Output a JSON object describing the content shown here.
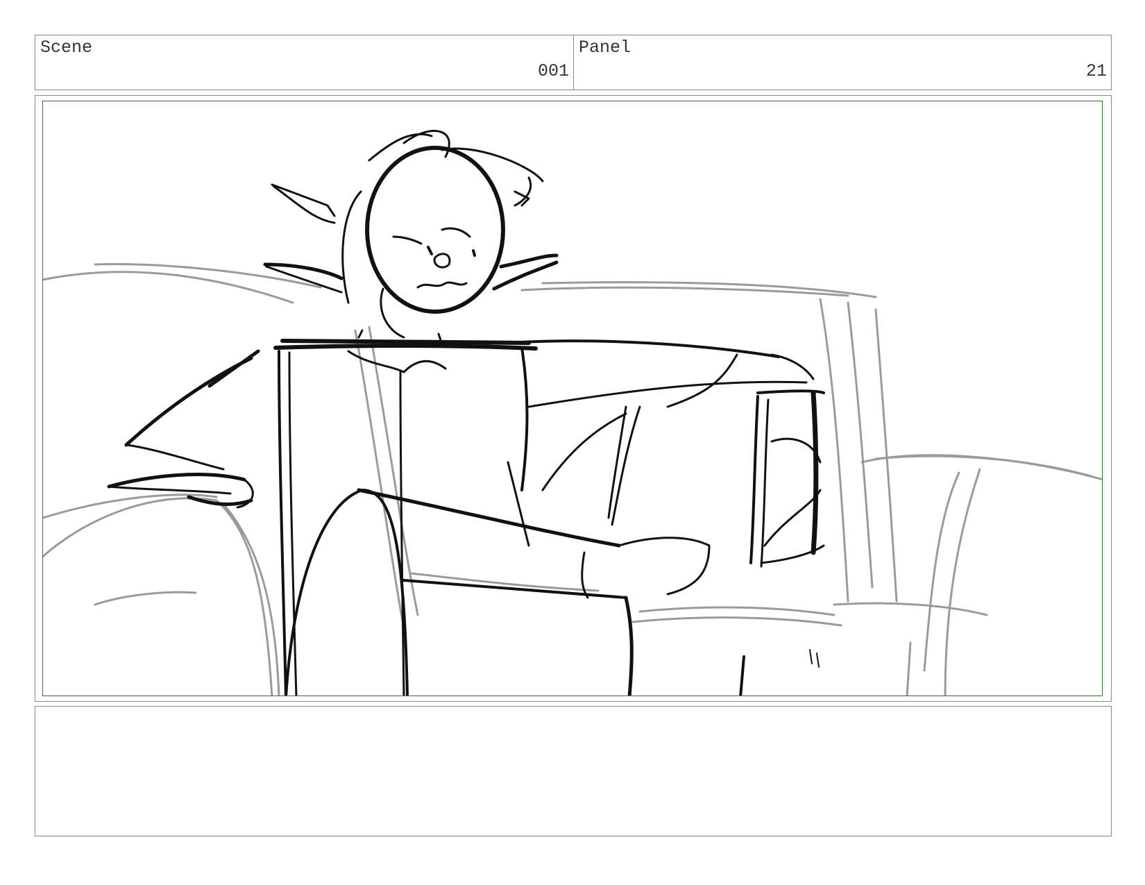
{
  "header": {
    "scene_label": "Scene",
    "scene_value": "001",
    "panel_label": "Panel",
    "panel_value": "21"
  },
  "frame": {
    "border_color": "#2f7a2f",
    "content": "sketch"
  },
  "notes": {
    "text": ""
  }
}
